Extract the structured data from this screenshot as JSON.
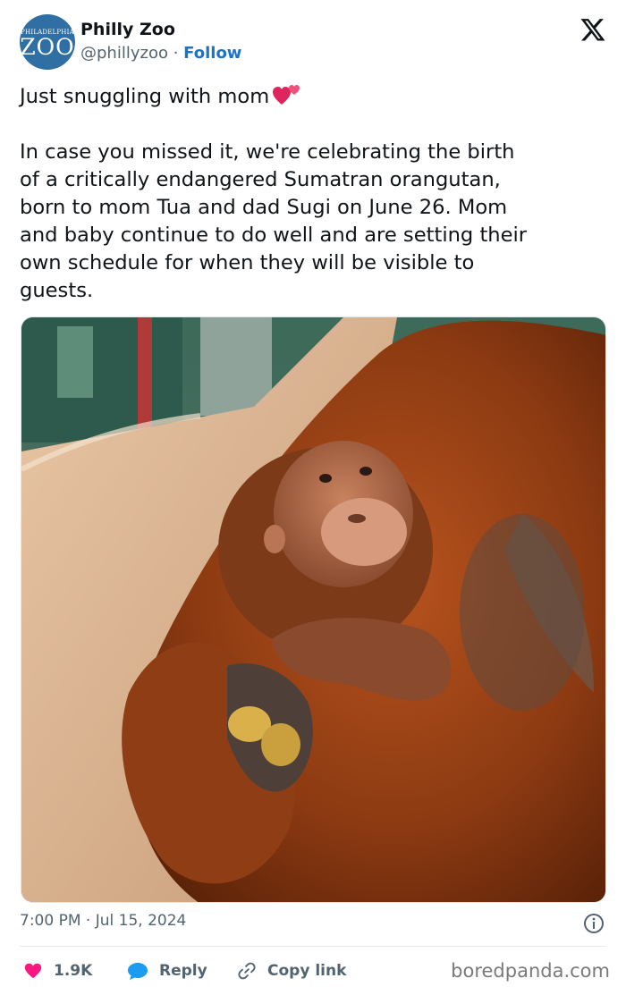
{
  "account": {
    "avatar_small_text": "PHILADELPHIA",
    "avatar_main_text": "ZOO",
    "name": "Philly Zoo",
    "handle": "@phillyzoo",
    "separator": "·",
    "follow_label": "Follow"
  },
  "tweet": {
    "line1": "Just snuggling with mom",
    "emoji": "two-hearts-icon",
    "paragraph_lines": [
      "In case you missed it, we're celebrating the birth",
      "of a critically endangered Sumatran orangutan,",
      "born to mom Tua and dad Sugi on June 26. Mom",
      "and baby continue to do well and are setting their",
      "own schedule for when they will be visible to",
      "guests."
    ]
  },
  "meta": {
    "timestamp": "7:00 PM · Jul 15, 2024"
  },
  "actions": {
    "like_count": "1.9K",
    "reply_label": "Reply",
    "copy_link_label": "Copy link"
  },
  "watermark": "boredpanda.com",
  "colors": {
    "link": "#1d73c9",
    "like": "#f91880",
    "reply": "#1d9bf0",
    "muted": "#536471"
  }
}
